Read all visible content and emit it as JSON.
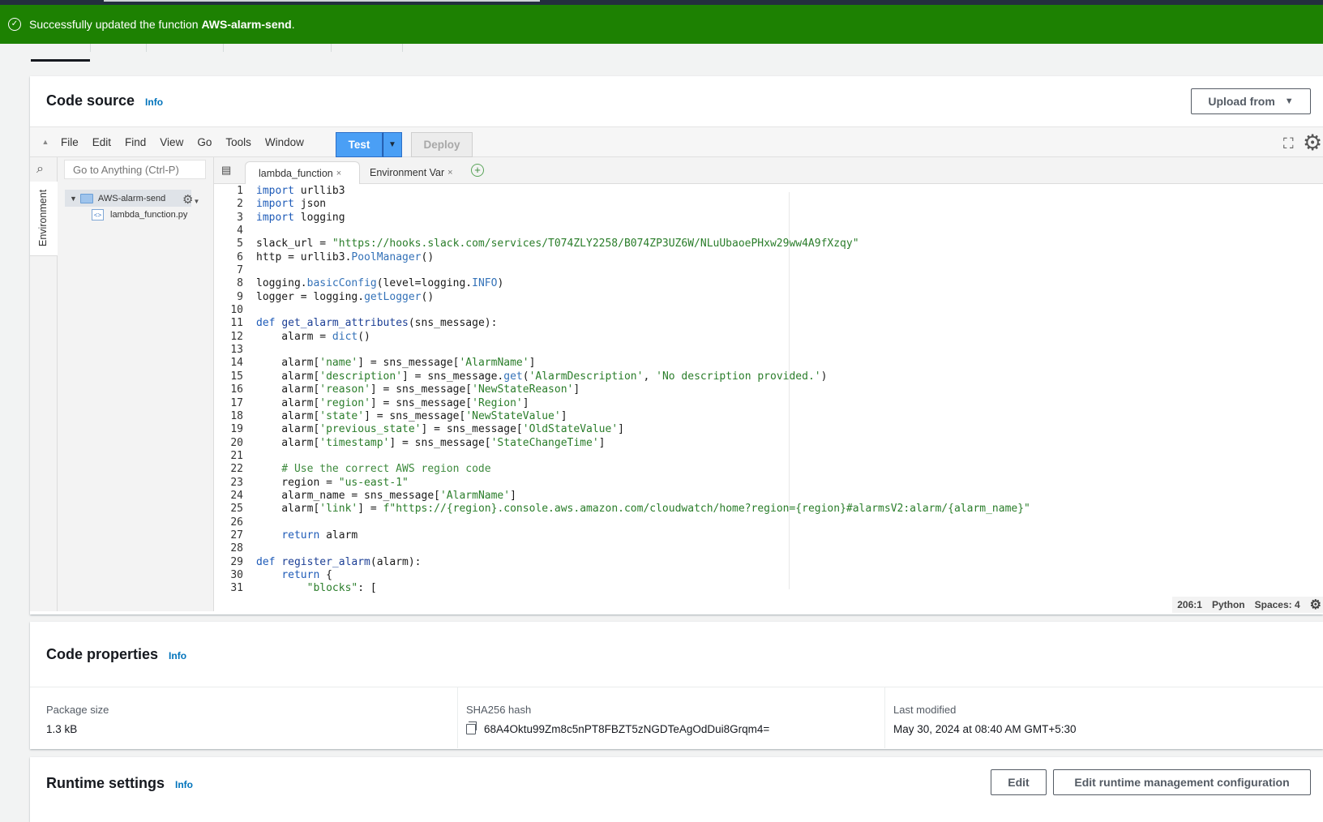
{
  "flash": {
    "prefix": "Successfully updated the function ",
    "function_name": "AWS-alarm-send",
    "suffix": "."
  },
  "code_source": {
    "title": "Code source",
    "info": "Info",
    "upload_label": "Upload from",
    "menu": [
      "File",
      "Edit",
      "Find",
      "View",
      "Go",
      "Tools",
      "Window"
    ],
    "test_label": "Test",
    "deploy_label": "Deploy",
    "goto_placeholder": "Go to Anything (Ctrl-P)",
    "env_tab": "Environment",
    "folder": "AWS-alarm-send",
    "file": "lambda_function.py",
    "tabs": [
      "lambda_function",
      "Environment Var"
    ],
    "status": {
      "cursor": "206:1",
      "language": "Python",
      "spaces": "Spaces: 4"
    },
    "code_lines": [
      "import urllib3",
      "import json",
      "import logging",
      "",
      "slack_url = \"https://hooks.slack.com/services/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\"",
      "http = urllib3.PoolManager()",
      "",
      "logging.basicConfig(level=logging.INFO)",
      "logger = logging.getLogger()",
      "",
      "def get_alarm_attributes(sns_message):",
      "    alarm = dict()",
      "",
      "    alarm['name'] = sns_message['AlarmName']",
      "    alarm['description'] = sns_message.get('AlarmDescription', 'No description provided.')",
      "    alarm['reason'] = sns_message['NewStateReason']",
      "    alarm['region'] = sns_message['Region']",
      "    alarm['state'] = sns_message['NewStateValue']",
      "    alarm['previous_state'] = sns_message['OldStateValue']",
      "    alarm['timestamp'] = sns_message['StateChangeTime']",
      "",
      "    # Use the correct AWS region code",
      "    region = \"us-east-1\"",
      "    alarm_name = sns_message['AlarmName']",
      "    alarm['link'] = f\"https://{region}.console.aws.amazon.com/cloudwatch/home?region={region}#alarmsV2:alarm/{alarm_name}\"",
      "",
      "    return alarm",
      "",
      "def register_alarm(alarm):",
      "    return {",
      "        \"blocks\": ["
    ]
  },
  "code_properties": {
    "title": "Code properties",
    "info": "Info",
    "items": [
      {
        "label": "Package size",
        "value": "1.3 kB"
      },
      {
        "label": "SHA256 hash",
        "value": "68A4Oktu99Zm8c5nPT8FBZT5zNGDTeAgOdDui8Grqm4="
      },
      {
        "label": "Last modified",
        "value": "May 30, 2024 at 08:40 AM GMT+5:30"
      }
    ]
  },
  "runtime_settings": {
    "title": "Runtime settings",
    "info": "Info",
    "edit_label": "Edit",
    "edit_runtime_label": "Edit runtime management configuration"
  }
}
